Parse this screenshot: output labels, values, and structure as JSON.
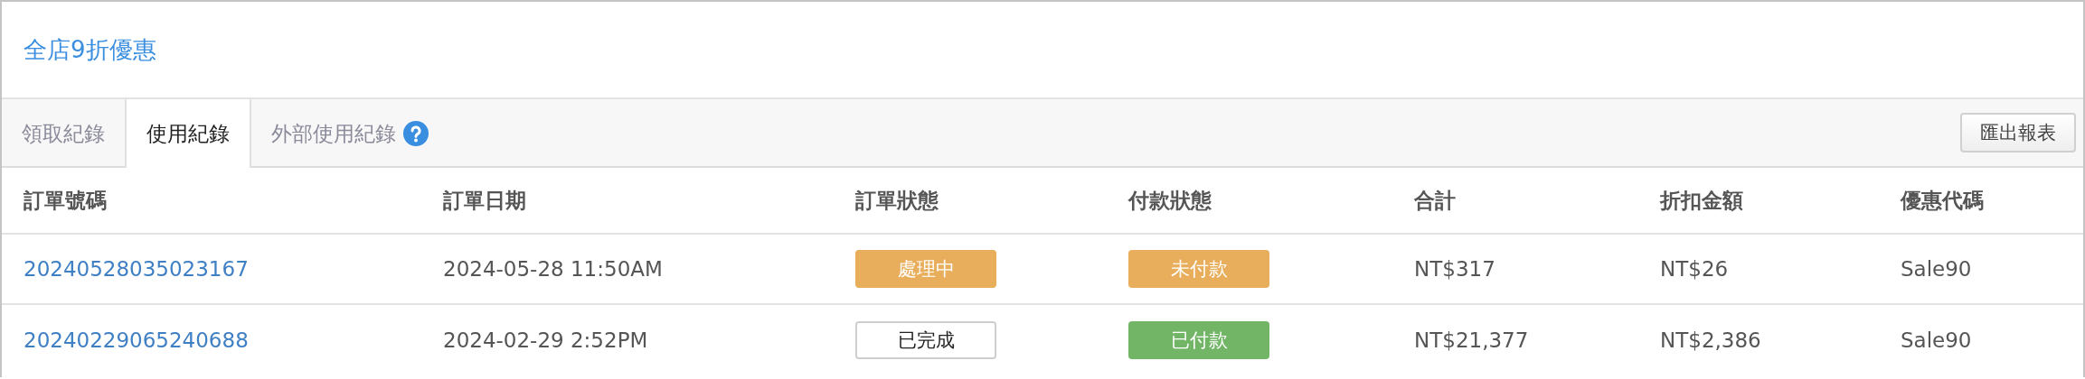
{
  "title": "全店9折優惠",
  "tabs": [
    {
      "label": "領取紀錄",
      "selected": false
    },
    {
      "label": "使用紀錄",
      "selected": true
    },
    {
      "label": "外部使用紀錄",
      "selected": false,
      "help": true
    }
  ],
  "export_button": "匯出報表",
  "table": {
    "columns": [
      "訂單號碼",
      "訂單日期",
      "訂單狀態",
      "付款狀態",
      "合計",
      "折扣金額",
      "優惠代碼"
    ],
    "rows": [
      {
        "order_no": "20240528035023167",
        "date": "2024-05-28 11:50AM",
        "order_status": {
          "label": "處理中",
          "kind": "warning"
        },
        "payment_status": {
          "label": "未付款",
          "kind": "warning"
        },
        "total": "NT$317",
        "discount": "NT$26",
        "code": "Sale90"
      },
      {
        "order_no": "20240229065240688",
        "date": "2024-02-29 2:52PM",
        "order_status": {
          "label": "已完成",
          "kind": "plain"
        },
        "payment_status": {
          "label": "已付款",
          "kind": "success"
        },
        "total": "NT$21,377",
        "discount": "NT$2,386",
        "code": "Sale90"
      }
    ]
  }
}
